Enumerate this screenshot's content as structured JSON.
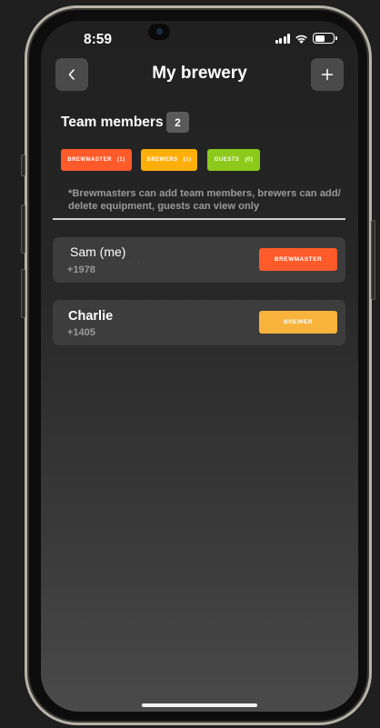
{
  "status_bar": {
    "time": "8:59"
  },
  "header": {
    "title": "My brewery",
    "back_icon": "chevron-left-icon",
    "add_icon": "plus-icon"
  },
  "team": {
    "heading": "Team members",
    "count": "2",
    "chips": [
      {
        "label": "BREWMASTER",
        "count": "(1)",
        "color": "#ff5a2a"
      },
      {
        "label": "BREWERS",
        "count": "(1)",
        "color": "#ffae0a"
      },
      {
        "label": "GUESTS",
        "count": "(0)",
        "color": "#8cc91a"
      }
    ],
    "note": "*Brewmasters can add team members, brewers can add/ delete equipment, guests can view only"
  },
  "members": [
    {
      "name": "Sam (me)",
      "phone": "+1978",
      "role": "BREWMASTER",
      "role_color": "#ff5a2a"
    },
    {
      "name": "Charlie",
      "phone": "+1405",
      "role": "BREWER",
      "role_color": "#f7b33c"
    }
  ]
}
